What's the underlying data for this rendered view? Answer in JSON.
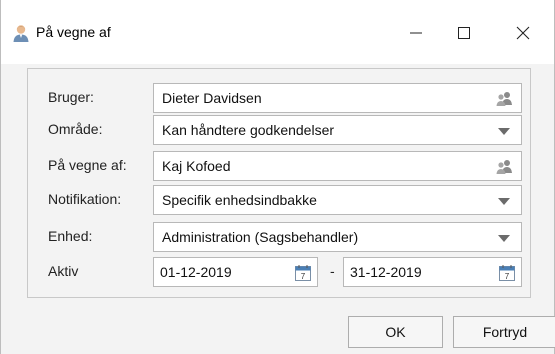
{
  "window": {
    "title": "På vegne af",
    "controls": {
      "minimize_icon": "minimize-icon",
      "maximize_icon": "maximize-icon",
      "close_icon": "close-icon"
    }
  },
  "form": {
    "bruger": {
      "label": "Bruger:",
      "value": "Dieter Davidsen",
      "icon": "user-group-icon"
    },
    "omraade": {
      "label": "Område:",
      "value": "Kan håndtere godkendelser",
      "icon": "chevron-down-icon"
    },
    "paa_vegne_af": {
      "label": "På vegne af:",
      "value": "Kaj Kofoed",
      "icon": "user-group-icon"
    },
    "notifikation": {
      "label": "Notifikation:",
      "value": "Specifik enhedsindbakke",
      "icon": "chevron-down-icon"
    },
    "enhed": {
      "label": "Enhed:",
      "value": "Administration (Sagsbehandler)",
      "icon": "chevron-down-icon"
    },
    "aktiv": {
      "label": "Aktiv",
      "from": "01-12-2019",
      "separator": "-",
      "to": "31-12-2019",
      "icon": "calendar-icon"
    }
  },
  "buttons": {
    "ok_label": "OK",
    "cancel_label": "Fortryd"
  },
  "colors": {
    "window_bg": "#f3f3f3",
    "field_border": "#b8b8b8",
    "caret": "#6b6b6b"
  }
}
